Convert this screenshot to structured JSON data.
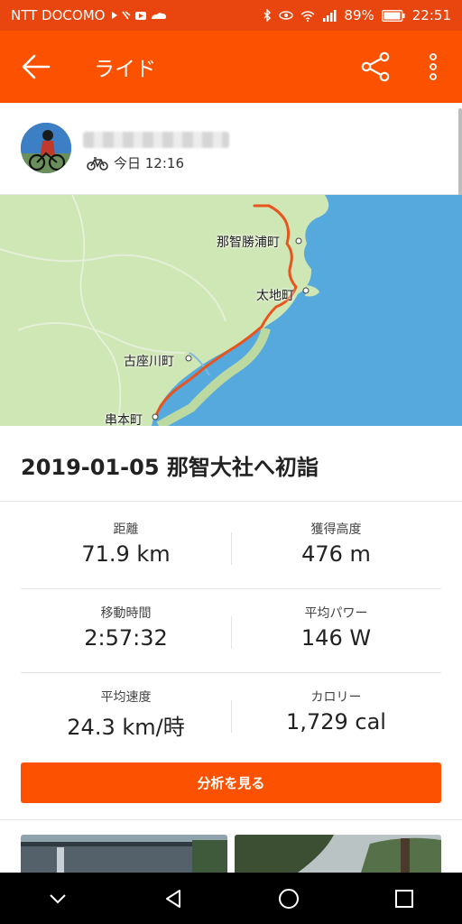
{
  "status_bar": {
    "carrier": "NTT DOCOMO",
    "battery": "89%",
    "time": "22:51"
  },
  "app_bar": {
    "title": "ライド",
    "back_icon": "arrow-left-icon",
    "share_icon": "share-icon",
    "more_icon": "more-vertical-icon"
  },
  "profile": {
    "time_label": "今日 12:16",
    "activity_icon": "bicycle-icon"
  },
  "map": {
    "labels": [
      "那智勝浦町",
      "太地町",
      "古座川町",
      "串本町"
    ],
    "route_color": "#e8541e",
    "sea_color": "#55a9dc",
    "land_color": "#cfe6b5"
  },
  "activity": {
    "title": "2019-01-05 那智大社へ初詣"
  },
  "stats": [
    [
      {
        "label": "距離",
        "value": "71.9 km"
      },
      {
        "label": "獲得高度",
        "value": "476 m"
      }
    ],
    [
      {
        "label": "移動時間",
        "value": "2:57:32"
      },
      {
        "label": "平均パワー",
        "value": "146 W"
      }
    ],
    [
      {
        "label": "平均速度",
        "value": "24.3 km/時"
      },
      {
        "label": "カロリー",
        "value": "1,729 cal"
      }
    ]
  ],
  "analysis_button": "分析を見る",
  "colors": {
    "accent": "#fc5200",
    "status_bar": "#e8450f"
  },
  "nav_bar": {
    "icons": [
      "chevron-down-icon",
      "back-triangle-icon",
      "home-circle-icon",
      "recents-square-icon"
    ]
  }
}
